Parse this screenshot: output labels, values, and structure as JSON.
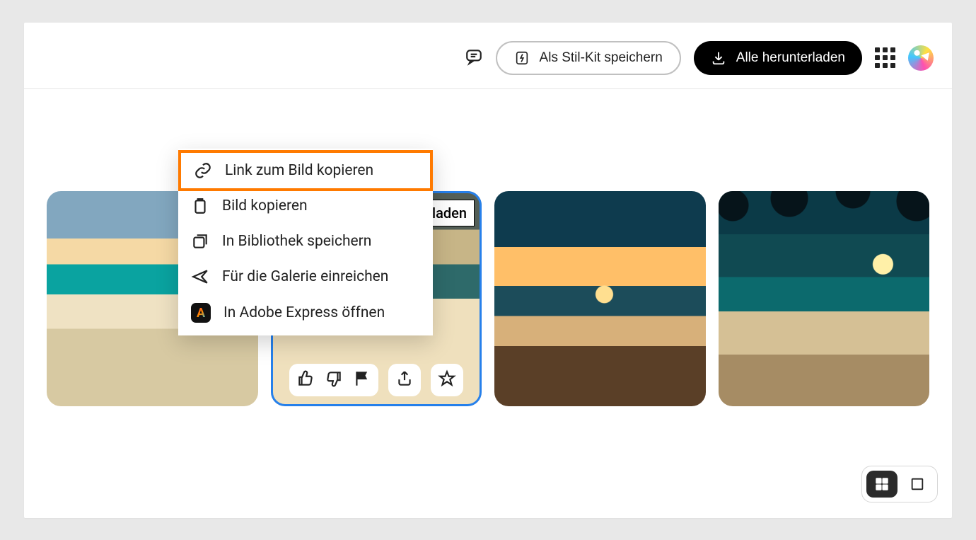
{
  "header": {
    "stylekit_label": "Als Stil-Kit speichern",
    "download_label": "Alle herunterladen"
  },
  "selected_overlay": {
    "peek_label": "erladen"
  },
  "context_menu": {
    "items": [
      {
        "label": "Link zum Bild kopieren"
      },
      {
        "label": "Bild kopieren"
      },
      {
        "label": "In Bibliothek speichern"
      },
      {
        "label": "Für die Galerie einreichen"
      },
      {
        "label": "In Adobe Express öffnen"
      }
    ]
  }
}
